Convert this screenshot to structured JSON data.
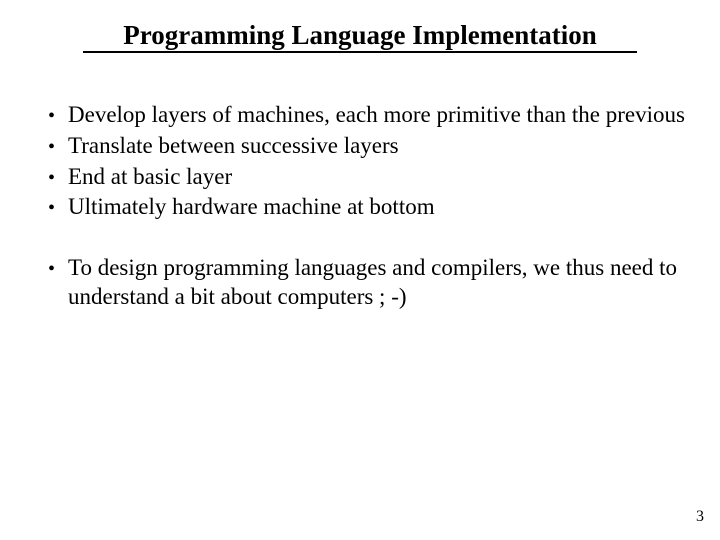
{
  "title": "Programming Language Implementation",
  "bullets_group1": [
    "Develop layers of machines, each more primitive than the previous",
    "Translate between  successive layers",
    "End at basic layer",
    "Ultimately hardware machine at bottom"
  ],
  "bullets_group2": [
    "To design programming languages and compilers, we thus need to understand a bit about computers ; -)"
  ],
  "page_number": "3"
}
